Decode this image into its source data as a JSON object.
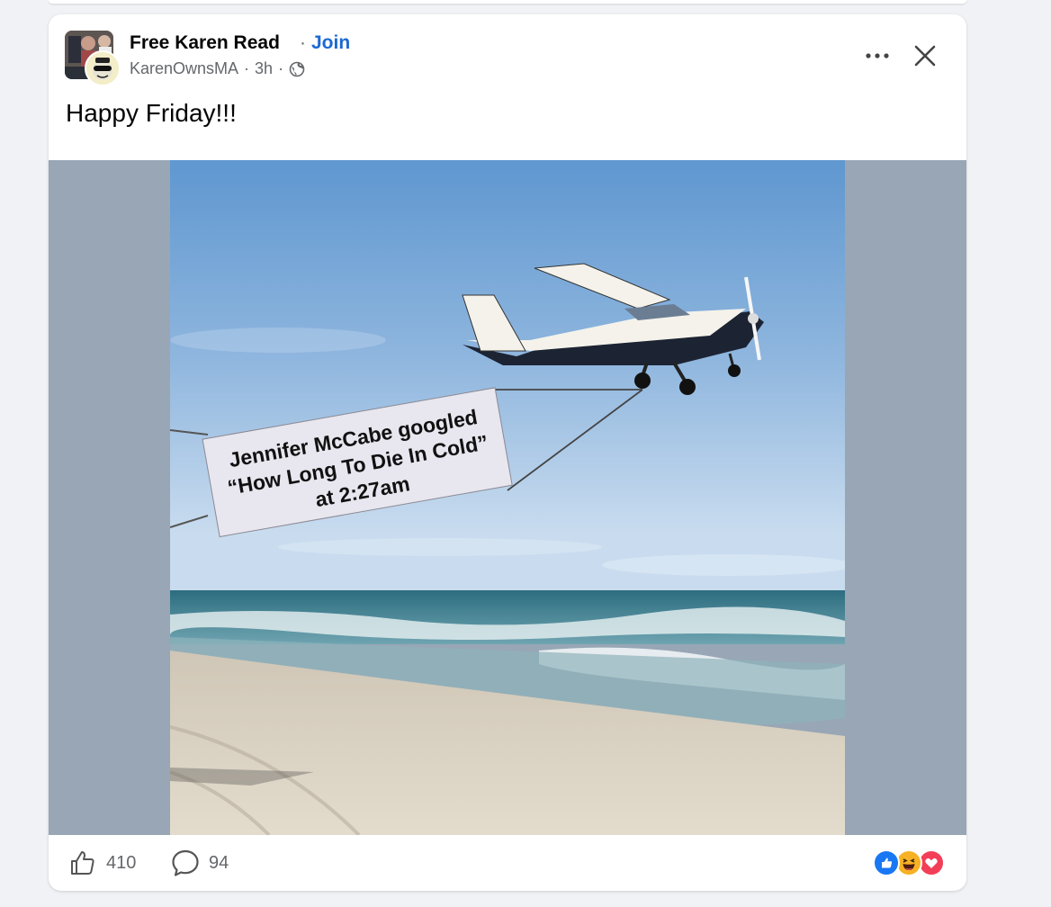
{
  "post": {
    "group_name": "Free Karen Read",
    "join_label": "Join",
    "author": "KarenOwnsMA",
    "time": "3h",
    "privacy_icon": "globe-icon",
    "text": "Happy Friday!!!",
    "image": {
      "banner_lines": [
        "Jennifer McCabe googled",
        "“How Long To Die In Cold”",
        "at 2:27am"
      ]
    }
  },
  "footer": {
    "like_count": "410",
    "comment_count": "94",
    "reactions": [
      "like",
      "haha",
      "love"
    ]
  },
  "colors": {
    "accent": "#1b6ad1",
    "secondary_text": "#65676b",
    "background": "#f0f2f5",
    "media_backdrop": "#98a6b5",
    "like_blue": "#1877f2",
    "love_red": "#f33e58",
    "haha_yellow": "#f7b125"
  }
}
